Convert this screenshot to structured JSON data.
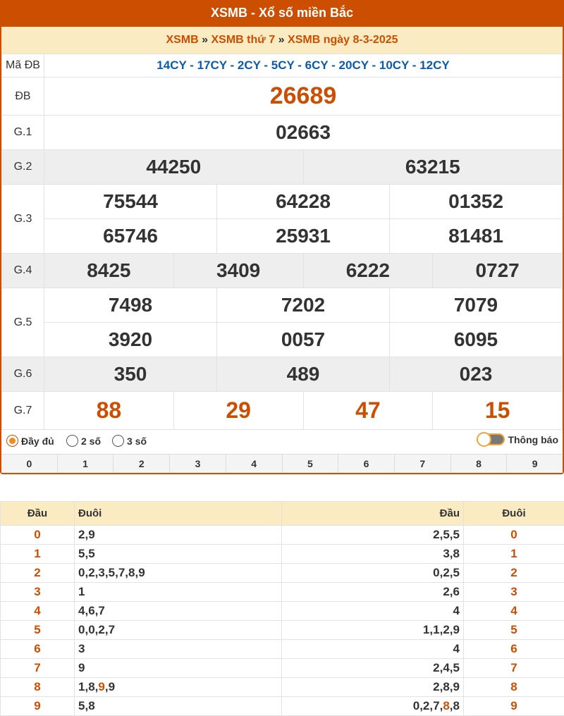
{
  "header": {
    "title": "XSMB - Xổ số miền Bắc"
  },
  "breadcrumb": {
    "l1": "XSMB",
    "sep1": "»",
    "l2": "XSMB thứ 7",
    "sep2": "»",
    "l3": "XSMB ngày 8-3-2025"
  },
  "results": {
    "madb_label": "Mã ĐB",
    "madb": "14CY - 17CY - 2CY - 5CY - 6CY - 20CY - 10CY - 12CY",
    "db_label": "ĐB",
    "db": "26689",
    "g1_label": "G.1",
    "g1": "02663",
    "g2_label": "G.2",
    "g2": [
      "44250",
      "63215"
    ],
    "g3_label": "G.3",
    "g3": [
      "75544",
      "64228",
      "01352",
      "65746",
      "25931",
      "81481"
    ],
    "g4_label": "G.4",
    "g4": [
      "8425",
      "3409",
      "6222",
      "0727"
    ],
    "g5_label": "G.5",
    "g5": [
      "7498",
      "7202",
      "7079",
      "3920",
      "0057",
      "6095"
    ],
    "g6_label": "G.6",
    "g6": [
      "350",
      "489",
      "023"
    ],
    "g7_label": "G.7",
    "g7": [
      "88",
      "29",
      "47",
      "15"
    ]
  },
  "options": {
    "full": "Đầy đủ",
    "two": "2 số",
    "three": "3 số",
    "toggle_label": "Thông báo",
    "selected": "full"
  },
  "digits": [
    "0",
    "1",
    "2",
    "3",
    "4",
    "5",
    "6",
    "7",
    "8",
    "9"
  ],
  "loto": {
    "h_dau": "Đầu",
    "h_duoi": "Đuôi",
    "rows": [
      {
        "d": "0",
        "duoi": [
          "2",
          "9"
        ],
        "hl1": [],
        "left": [
          "2",
          "5",
          "5"
        ],
        "hl2": []
      },
      {
        "d": "1",
        "duoi": [
          "5",
          "5"
        ],
        "hl1": [],
        "left": [
          "3",
          "8"
        ],
        "hl2": []
      },
      {
        "d": "2",
        "duoi": [
          "0",
          "2",
          "3",
          "5",
          "7",
          "8",
          "9"
        ],
        "hl1": [],
        "left": [
          "0",
          "2",
          "5"
        ],
        "hl2": []
      },
      {
        "d": "3",
        "duoi": [
          "1"
        ],
        "hl1": [],
        "left": [
          "2",
          "6"
        ],
        "hl2": []
      },
      {
        "d": "4",
        "duoi": [
          "4",
          "6",
          "7"
        ],
        "hl1": [],
        "left": [
          "4"
        ],
        "hl2": []
      },
      {
        "d": "5",
        "duoi": [
          "0",
          "0",
          "2",
          "7"
        ],
        "hl1": [],
        "left": [
          "1",
          "1",
          "2",
          "9"
        ],
        "hl2": []
      },
      {
        "d": "6",
        "duoi": [
          "3"
        ],
        "hl1": [],
        "left": [
          "4"
        ],
        "hl2": []
      },
      {
        "d": "7",
        "duoi": [
          "9"
        ],
        "hl1": [],
        "left": [
          "2",
          "4",
          "5"
        ],
        "hl2": []
      },
      {
        "d": "8",
        "duoi": [
          "1",
          "8",
          "9",
          "9"
        ],
        "hl1": [
          2
        ],
        "left": [
          "2",
          "8",
          "9"
        ],
        "hl2": []
      },
      {
        "d": "9",
        "duoi": [
          "5",
          "8"
        ],
        "hl1": [],
        "left": [
          "0",
          "2",
          "7",
          "8",
          "8"
        ],
        "hl2": [
          3
        ]
      }
    ]
  },
  "colors": {
    "brand": "#cc4e00",
    "cream": "#faebc2",
    "madb": "#0a5ba8"
  }
}
